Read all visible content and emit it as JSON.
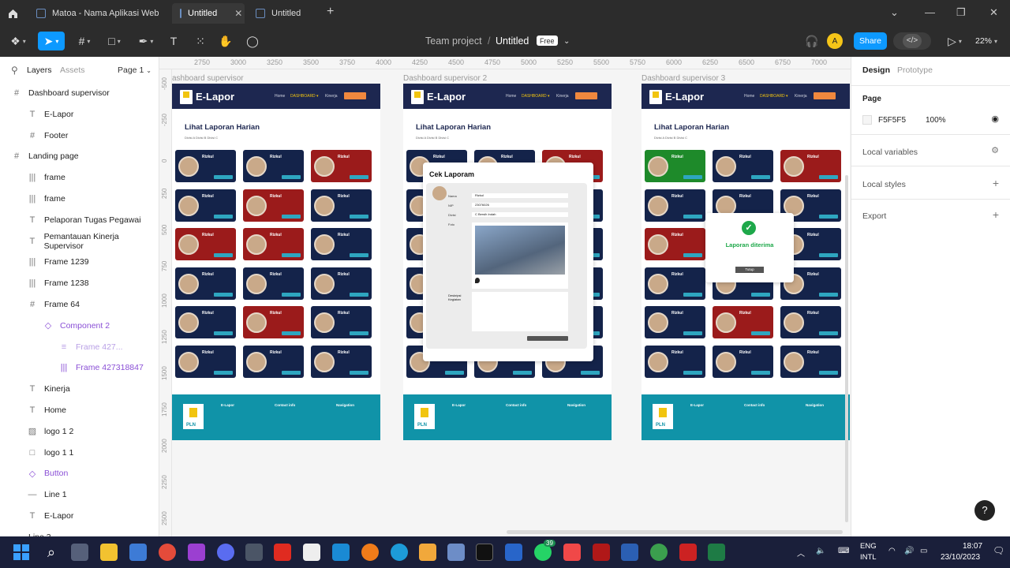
{
  "tabs": [
    {
      "label": "Matoa - Nama Aplikasi Web"
    },
    {
      "label": "Untitled"
    },
    {
      "label": "Untitled"
    }
  ],
  "toolbar": {
    "team": "Team project",
    "separator": "/",
    "file": "Untitled",
    "badge": "Free",
    "share": "Share",
    "avatar": "A",
    "zoom": "22%"
  },
  "left_panel": {
    "tabs": [
      "Layers",
      "Assets"
    ],
    "page": "Page 1",
    "layers": [
      {
        "label": "Dashboard supervisor",
        "icon": "#",
        "indent": 0,
        "color": "#222"
      },
      {
        "label": "E-Lapor",
        "icon": "T",
        "indent": 1,
        "color": "#222"
      },
      {
        "label": "Footer",
        "icon": "#",
        "indent": 1,
        "color": "#222"
      },
      {
        "label": "Landing page",
        "icon": "#",
        "indent": 0,
        "color": "#222"
      },
      {
        "label": "frame",
        "icon": "|||",
        "indent": 1,
        "color": "#222"
      },
      {
        "label": "frame",
        "icon": "|||",
        "indent": 1,
        "color": "#222"
      },
      {
        "label": "Pelaporan Tugas Pegawai",
        "icon": "T",
        "indent": 1,
        "color": "#222"
      },
      {
        "label": "Pemantauan Kinerja Supervisor",
        "icon": "T",
        "indent": 1,
        "color": "#222"
      },
      {
        "label": "Frame 1239",
        "icon": "|||",
        "indent": 1,
        "color": "#222"
      },
      {
        "label": "Frame 1238",
        "icon": "|||",
        "indent": 1,
        "color": "#222"
      },
      {
        "label": "Frame 64",
        "icon": "#",
        "indent": 1,
        "color": "#222"
      },
      {
        "label": "Component 2",
        "icon": "◇",
        "indent": 2,
        "color": "#8a4fd6"
      },
      {
        "label": "Frame 427...",
        "icon": "≡",
        "indent": 3,
        "color": "#b9a0e6"
      },
      {
        "label": "Frame 427318847",
        "icon": "|||",
        "indent": 3,
        "color": "#8a4fd6"
      },
      {
        "label": "Kinerja",
        "icon": "T",
        "indent": 1,
        "color": "#222"
      },
      {
        "label": "Home",
        "icon": "T",
        "indent": 1,
        "color": "#222"
      },
      {
        "label": "logo 1 2",
        "icon": "▨",
        "indent": 1,
        "color": "#222"
      },
      {
        "label": "logo 1 1",
        "icon": "□",
        "indent": 1,
        "color": "#222"
      },
      {
        "label": "Button",
        "icon": "◇",
        "indent": 1,
        "color": "#8a4fd6"
      },
      {
        "label": "Line 1",
        "icon": "—",
        "indent": 1,
        "color": "#222"
      },
      {
        "label": "E-Lapor",
        "icon": "T",
        "indent": 1,
        "color": "#222"
      },
      {
        "label": "Line 3",
        "icon": "—",
        "indent": 0,
        "color": "#222"
      }
    ]
  },
  "ruler": {
    "top": [
      "2750",
      "3000",
      "3250",
      "3500",
      "3750",
      "4000",
      "4250",
      "4500",
      "4750",
      "5000",
      "5250",
      "5500",
      "5750",
      "6000",
      "6250",
      "6500",
      "6750",
      "7000"
    ],
    "left": [
      "-500",
      "-250",
      "0",
      "250",
      "500",
      "750",
      "1000",
      "1250",
      "1500",
      "1750",
      "2000",
      "2250",
      "2500"
    ]
  },
  "frames": [
    {
      "label": "ashboard supervisor",
      "brand": "E-Lapor",
      "title": "Lihat Laporan Harian",
      "sub": "Divisi A   Divisi B   Divisi C"
    },
    {
      "label": "Dashboard supervisor 2",
      "brand": "E-Lapor",
      "title": "Lihat Laporan Harian",
      "sub": "Divisi A   Divisi B   Divisi C"
    },
    {
      "label": "Dashboard  supervisor 3",
      "brand": "E-Lapor",
      "title": "Lihat Laporan Harian",
      "sub": "Divisi A   Divisi B   Divisi C"
    }
  ],
  "card_name": "Rizkul",
  "footer": {
    "brand": "E-Lapor",
    "contact": "Contact info",
    "nav": "Navigation",
    "logo": "PLN"
  },
  "modal": {
    "title": "Cek Laporam",
    "fields": [
      "Nama",
      "NIP",
      "Divisi",
      "Foto"
    ],
    "values": [
      "Rizkul",
      "23076026",
      "C Bersih Indah"
    ],
    "desc_label": "Deskripsi Kegiatan"
  },
  "success": {
    "title": "Laporan diterima",
    "button": "Tutup"
  },
  "right_panel": {
    "tabs": [
      "Design",
      "Prototype"
    ],
    "page_label": "Page",
    "color": "F5F5F5",
    "opacity": "100%",
    "sections": [
      "Local variables",
      "Local styles",
      "Export"
    ]
  },
  "taskbar": {
    "lang": "ENG",
    "lang2": "INTL",
    "time": "18:07",
    "date": "23/10/2023",
    "badge": "39"
  }
}
